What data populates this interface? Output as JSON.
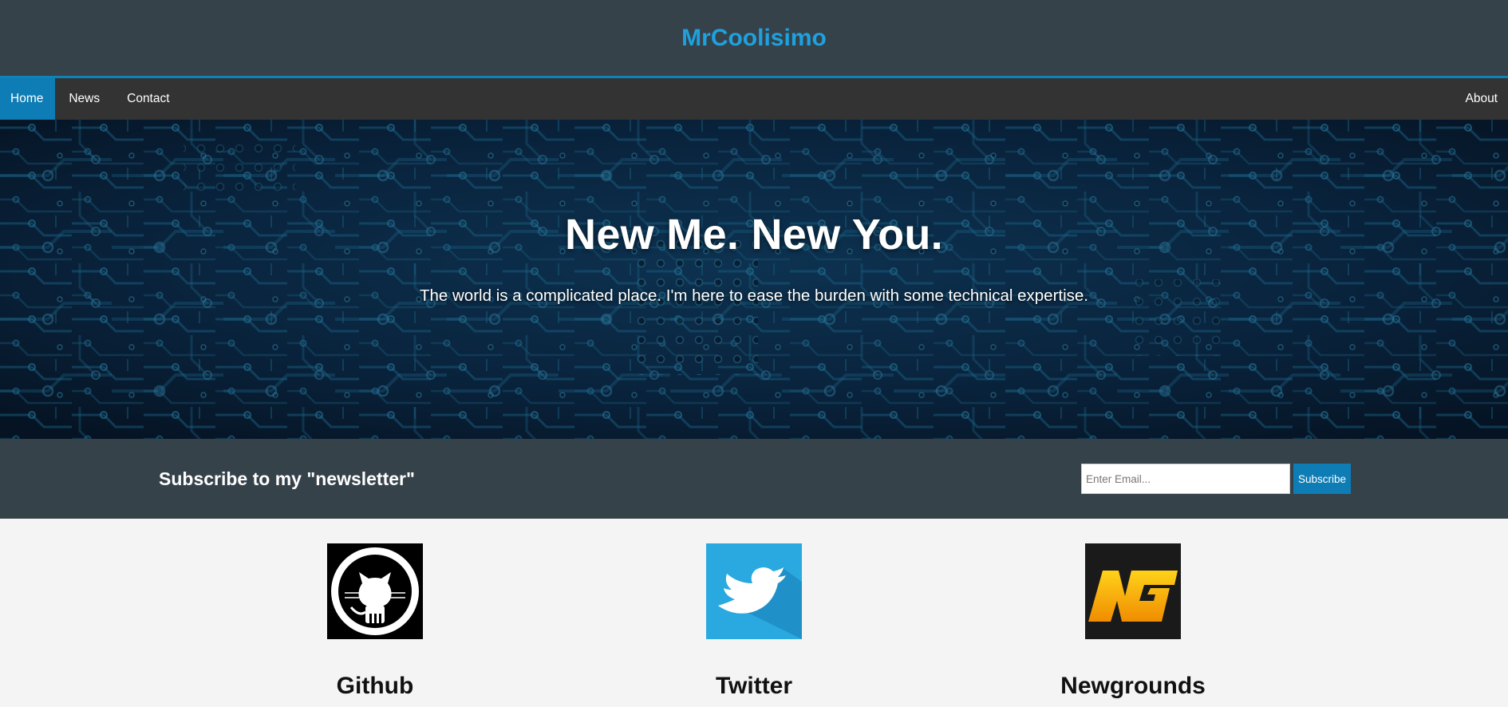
{
  "header": {
    "title": "MrCoolisimo"
  },
  "nav": {
    "left": [
      {
        "label": "Home",
        "active": true
      },
      {
        "label": "News",
        "active": false
      },
      {
        "label": "Contact",
        "active": false
      }
    ],
    "right": [
      {
        "label": "About"
      }
    ]
  },
  "hero": {
    "title": "New Me. New You.",
    "subtitle": "The world is a complicated place. I'm here to ease the burden with some technical expertise."
  },
  "newsletter": {
    "heading": "Subscribe to my \"newsletter\"",
    "email_placeholder": "Enter Email...",
    "email_value": "",
    "button_label": "Subscribe"
  },
  "socials": [
    {
      "name": "Github",
      "icon": "github-octocat-icon"
    },
    {
      "name": "Twitter",
      "icon": "twitter-bird-icon"
    },
    {
      "name": "Newgrounds",
      "icon": "newgrounds-ng-icon"
    }
  ],
  "colors": {
    "header_bg": "#35424a",
    "accent": "#0e7db5",
    "title": "#1ea1de",
    "nav_bg": "#333333",
    "page_bg": "#f4f4f4"
  }
}
